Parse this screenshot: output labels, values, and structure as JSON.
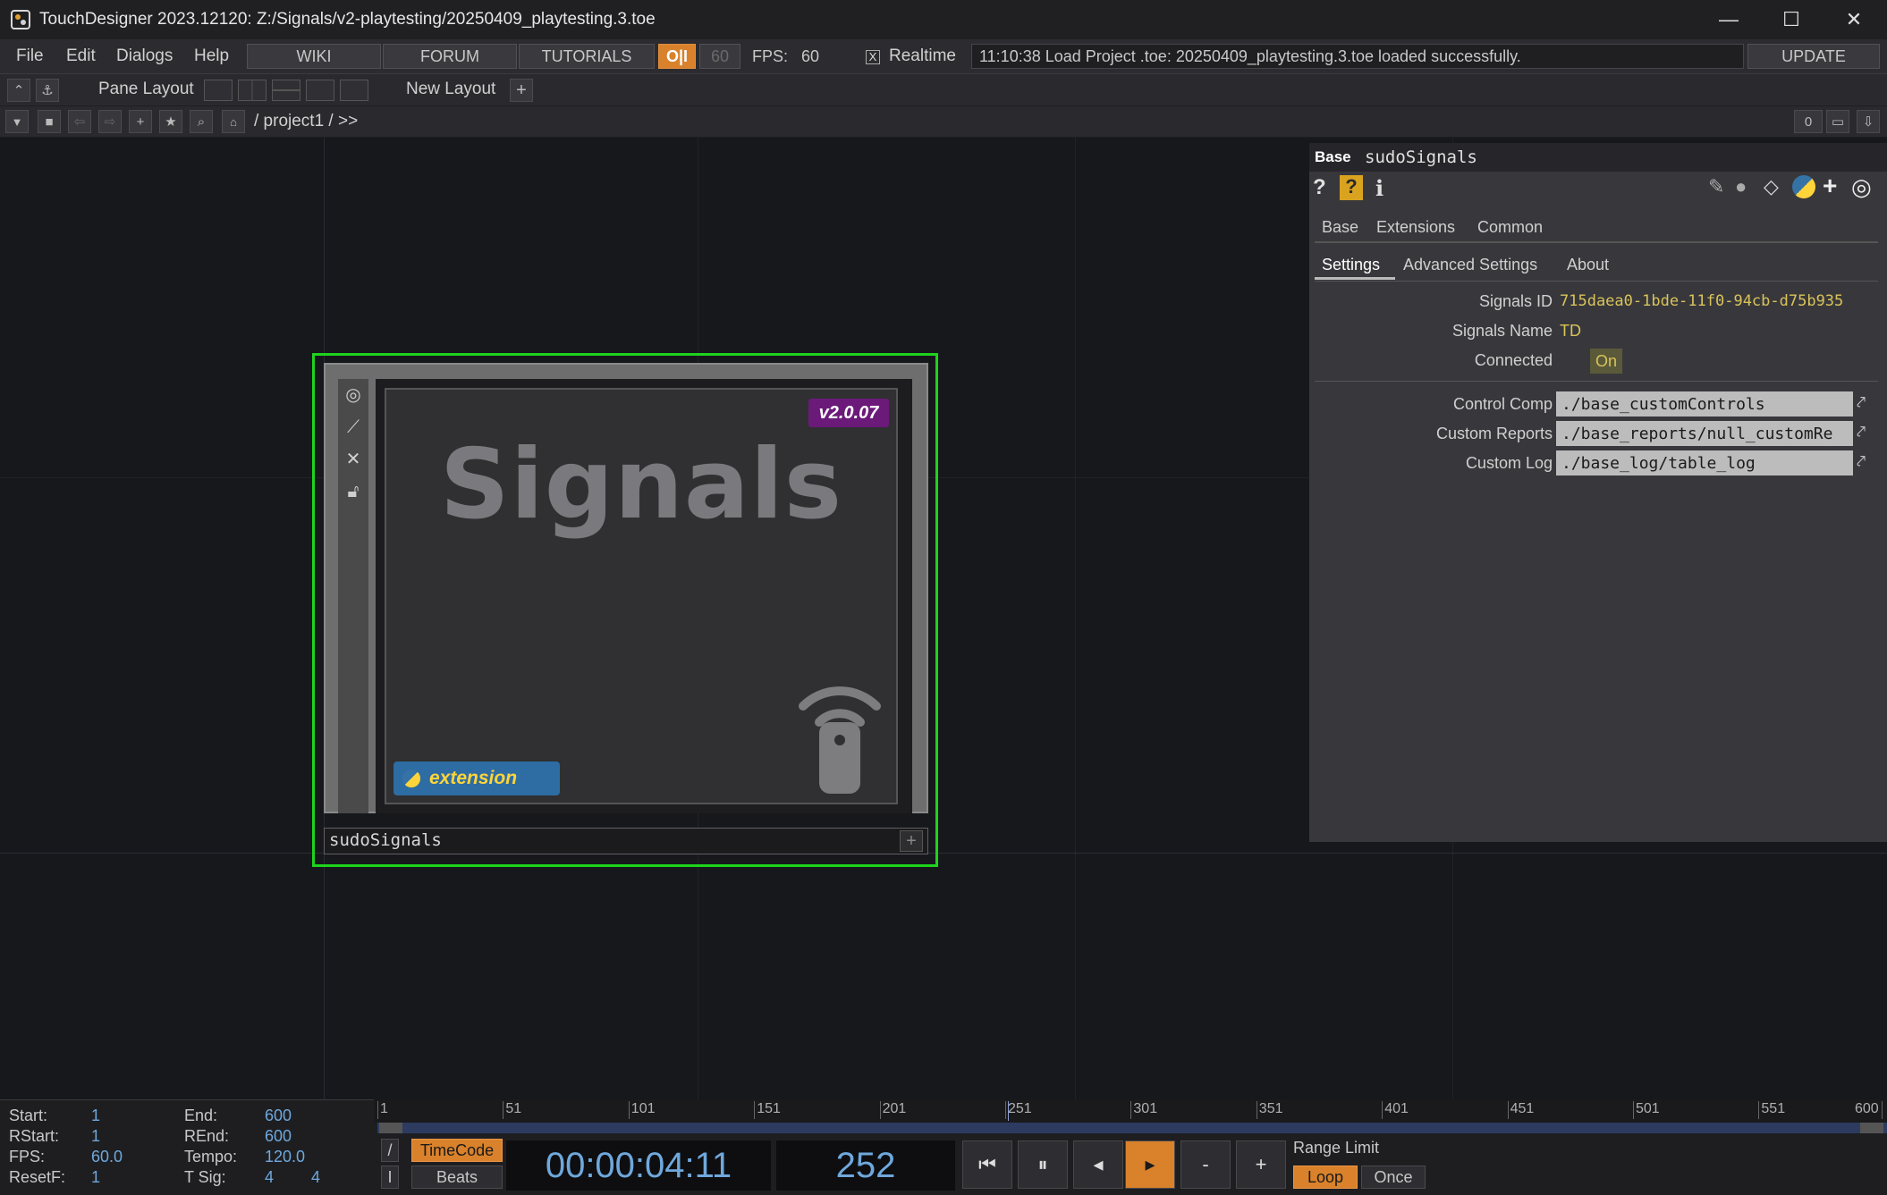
{
  "window": {
    "title": "TouchDesigner 2023.12120: Z:/Signals/v2-playtesting/20250409_playtesting.3.toe",
    "minimize": "—",
    "maximize": "☐",
    "close": "✕"
  },
  "menubar": {
    "file": "File",
    "edit": "Edit",
    "dialogs": "Dialogs",
    "help": "Help",
    "wiki": "WIKI",
    "forum": "FORUM",
    "tutorials": "TUTORIALS",
    "oi": "O|I",
    "fps_target": "60",
    "fps_label": "FPS:",
    "fps_value": "60",
    "realtime_label": "Realtime",
    "realtime_checked": "X",
    "status_message": "11:10:38 Load Project .toe: 20250409_playtesting.3.toe loaded successfully.",
    "update": "UPDATE"
  },
  "panebar": {
    "pane_layout": "Pane Layout",
    "new_layout": "New Layout",
    "add": "+"
  },
  "navbar": {
    "path": "/ project1 / >>",
    "counter": "0"
  },
  "node": {
    "name": "sudoSignals",
    "title": "Signals",
    "version": "v2.0.07",
    "badge": "extension",
    "colors": {
      "select_border": "#1ed31e",
      "version_bg": "#6b1a7a",
      "badge_bg": "#2d6da3"
    }
  },
  "params": {
    "op_type": "Base",
    "op_name": "sudoSignals",
    "tabs_top": [
      "Base",
      "Extensions",
      "Common"
    ],
    "tabs_page": [
      "Settings",
      "Advanced Settings",
      "About"
    ],
    "active_page": "Settings",
    "signals_id_label": "Signals ID",
    "signals_id": "715daea0-1bde-11f0-94cb-d75b935",
    "signals_name_label": "Signals Name",
    "signals_name": "TD",
    "connected_label": "Connected",
    "connected": "On",
    "control_comp_label": "Control Comp",
    "control_comp": "./base_customControls",
    "custom_reports_label": "Custom Reports",
    "custom_reports": "./base_reports/null_customRe",
    "custom_log_label": "Custom Log",
    "custom_log": "./base_log/table_log"
  },
  "timeline": {
    "start_label": "Start:",
    "start": "1",
    "end_label": "End:",
    "end": "600",
    "rstart_label": "RStart:",
    "rstart": "1",
    "rend_label": "REnd:",
    "rend": "600",
    "fps_label": "FPS:",
    "fps": "60.0",
    "tempo_label": "Tempo:",
    "tempo": "120.0",
    "resetf_label": "ResetF:",
    "resetf": "1",
    "tsig_label": "T Sig:",
    "tsig_a": "4",
    "tsig_b": "4",
    "ticks": [
      "1",
      "51",
      "101",
      "151",
      "201",
      "251",
      "301",
      "351",
      "401",
      "451",
      "501",
      "551",
      "600"
    ],
    "timecode_btn": "TimeCode",
    "beats_btn": "Beats",
    "timecode": "00:00:04:11",
    "frame": "252",
    "minus": "-",
    "plus": "+",
    "range_limit": "Range Limit",
    "loop": "Loop",
    "once": "Once",
    "slash_btn": "/",
    "i_btn": "I"
  }
}
